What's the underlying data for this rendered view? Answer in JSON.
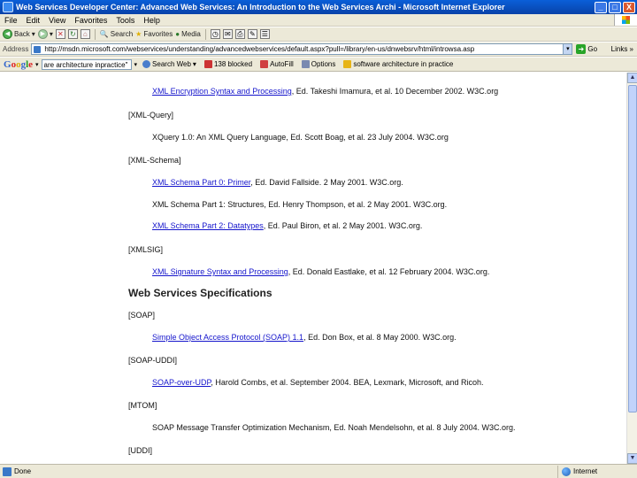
{
  "window": {
    "title": "Web Services Developer Center: Advanced Web Services: An Introduction to the Web Services Archi - Microsoft Internet Explorer",
    "buttons": [
      "_",
      "□",
      "X"
    ]
  },
  "menu": [
    "File",
    "Edit",
    "View",
    "Favorites",
    "Tools",
    "Help"
  ],
  "toolbar": {
    "back": "Back",
    "search": "Search",
    "favorites": "Favorites",
    "media": "Media"
  },
  "address": {
    "label": "Address",
    "url": "http://msdn.microsoft.com/webservices/understanding/advancedwebservices/default.aspx?pull=/library/en-us/dnwebsrv/html/introwsa.asp",
    "go": "Go",
    "links": "Links"
  },
  "google": {
    "search_value": "are architecture inpractice\"",
    "search_web": "Search Web",
    "blocked": "138 blocked",
    "autofill": "AutoFill",
    "options": "Options",
    "query_term": "software architecture in practice"
  },
  "content": {
    "items": [
      {
        "kind": "entry",
        "link": "XML Encryption Syntax and Processing",
        "rest": ", Ed. Takeshi Imamura, et al. 10 December 2002. W3C.org"
      },
      {
        "kind": "label",
        "text": "[XML-Query]"
      },
      {
        "kind": "entry",
        "link": "",
        "rest": "XQuery 1.0: An XML Query Language, Ed. Scott Boag, et al. 23 July 2004. W3C.org"
      },
      {
        "kind": "label",
        "text": "[XML-Schema]"
      },
      {
        "kind": "entry",
        "link": "XML Schema Part 0: Primer",
        "rest": ", Ed. David Fallside. 2 May 2001. W3C.org."
      },
      {
        "kind": "entry",
        "link": "",
        "rest": "XML Schema Part 1: Structures, Ed. Henry Thompson, et al. 2 May 2001. W3C.org."
      },
      {
        "kind": "entry",
        "link": "XML Schema Part 2: Datatypes",
        "rest": ", Ed. Paul Biron, et al. 2 May 2001. W3C.org."
      },
      {
        "kind": "label",
        "text": "[XMLSIG]"
      },
      {
        "kind": "entry",
        "link": "XML Signature Syntax and Processing",
        "rest": ", Ed. Donald Eastlake, et al. 12 February 2004. W3C.org."
      },
      {
        "kind": "heading",
        "text": "Web Services Specifications"
      },
      {
        "kind": "label",
        "text": "[SOAP]"
      },
      {
        "kind": "entry",
        "link": "Simple Object Access Protocol (SOAP) 1.1",
        "rest": ", Ed. Don Box, et al. 8 May 2000. W3C.org."
      },
      {
        "kind": "label",
        "text": "[SOAP-UDDI]"
      },
      {
        "kind": "entry",
        "link": "SOAP-over-UDP",
        "rest": ", Harold Combs, et al. September 2004. BEA, Lexmark, Microsoft, and Ricoh."
      },
      {
        "kind": "label",
        "text": "[MTOM]"
      },
      {
        "kind": "entry",
        "link": "",
        "rest": "SOAP Message Transfer Optimization Mechanism, Ed. Noah Mendelsohn, et al. 8 July 2004. W3C.org."
      },
      {
        "kind": "label",
        "text": "[UDDI]"
      }
    ]
  },
  "status": {
    "text": "Done",
    "zone": "Internet"
  }
}
